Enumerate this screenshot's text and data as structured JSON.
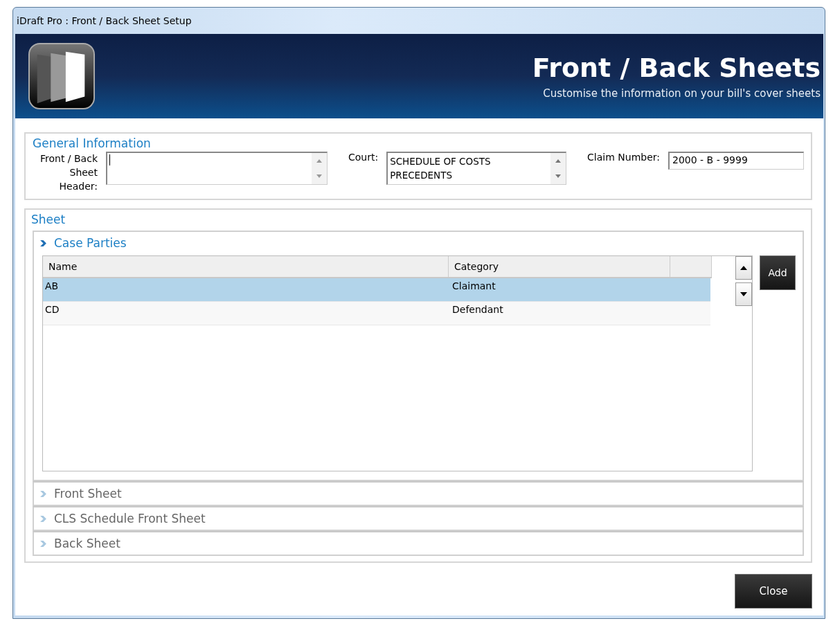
{
  "window": {
    "title": "iDraft Pro : Front / Back Sheet Setup"
  },
  "header": {
    "title": "Front / Back Sheets",
    "subtitle": "Customise the information on your bill's cover sheets"
  },
  "general_information": {
    "title": "General Information",
    "front_back_header": {
      "label": "Front / Back Sheet Header:"
    },
    "court": {
      "label": "Court:",
      "value": "SCHEDULE OF COSTS PRECEDENTS"
    },
    "claim_number": {
      "label": "Claim Number:",
      "value": "2000 - B - 9999"
    }
  },
  "sheet": {
    "title": "Sheet",
    "sections": [
      {
        "title": "Case Parties",
        "expanded": true
      },
      {
        "title": "Front Sheet",
        "expanded": false
      },
      {
        "title": "CLS Schedule Front Sheet",
        "expanded": false
      },
      {
        "title": "Back Sheet",
        "expanded": false
      }
    ]
  },
  "table": {
    "columns": [
      "Name",
      "Category"
    ],
    "rows": [
      {
        "cells": [
          "AB",
          "Claimant"
        ],
        "selected": true
      },
      {
        "cells": [
          "CD",
          "Defendant"
        ],
        "selected": false
      }
    ]
  },
  "buttons": {
    "add": "Add",
    "close": "Close"
  }
}
